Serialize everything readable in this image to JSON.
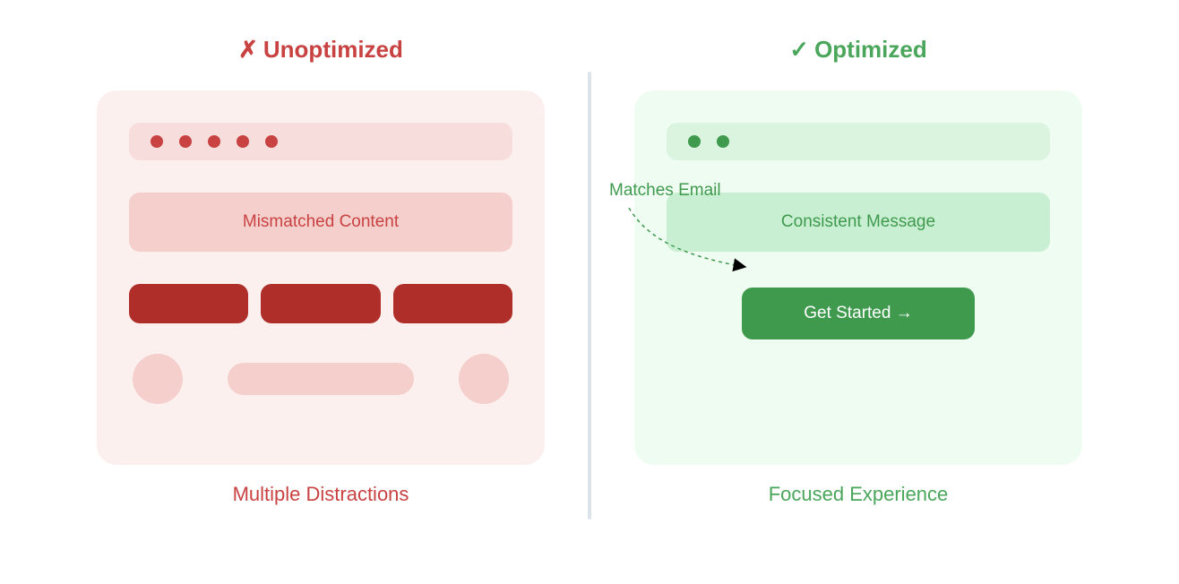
{
  "left": {
    "title_prefix": "✗",
    "title": "Unoptimized",
    "hero": "Mismatched Content",
    "caption": "Multiple Distractions"
  },
  "right": {
    "title_prefix": "✓",
    "title": "Optimized",
    "hero": "Consistent Message",
    "cta": "Get Started →",
    "caption": "Focused Experience"
  },
  "annotation": {
    "label": "Matches Email"
  }
}
